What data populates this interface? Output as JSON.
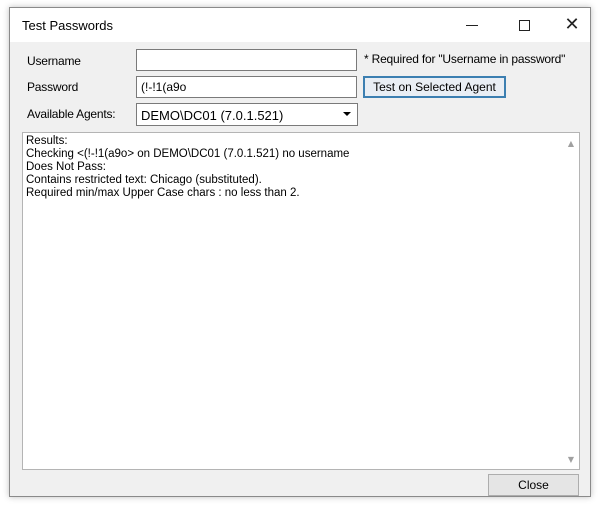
{
  "window": {
    "title": "Test Passwords"
  },
  "form": {
    "username_label": "Username",
    "username_value": "",
    "username_note": "* Required for \"Username in password\"",
    "password_label": "Password",
    "password_value": "(!-!1(a9o",
    "test_button": "Test on Selected Agent",
    "agents_label": "Available Agents:",
    "agents_selected": "DEMO\\DC01 (7.0.1.521)"
  },
  "results": {
    "lines": [
      "Results:",
      "Checking <(!-!1(a9o> on DEMO\\DC01 (7.0.1.521) no username",
      "Does Not Pass:",
      "Contains restricted text: Chicago (substituted).",
      "Required min/max Upper Case chars : no less than 2."
    ]
  },
  "footer": {
    "close_button": "Close"
  }
}
